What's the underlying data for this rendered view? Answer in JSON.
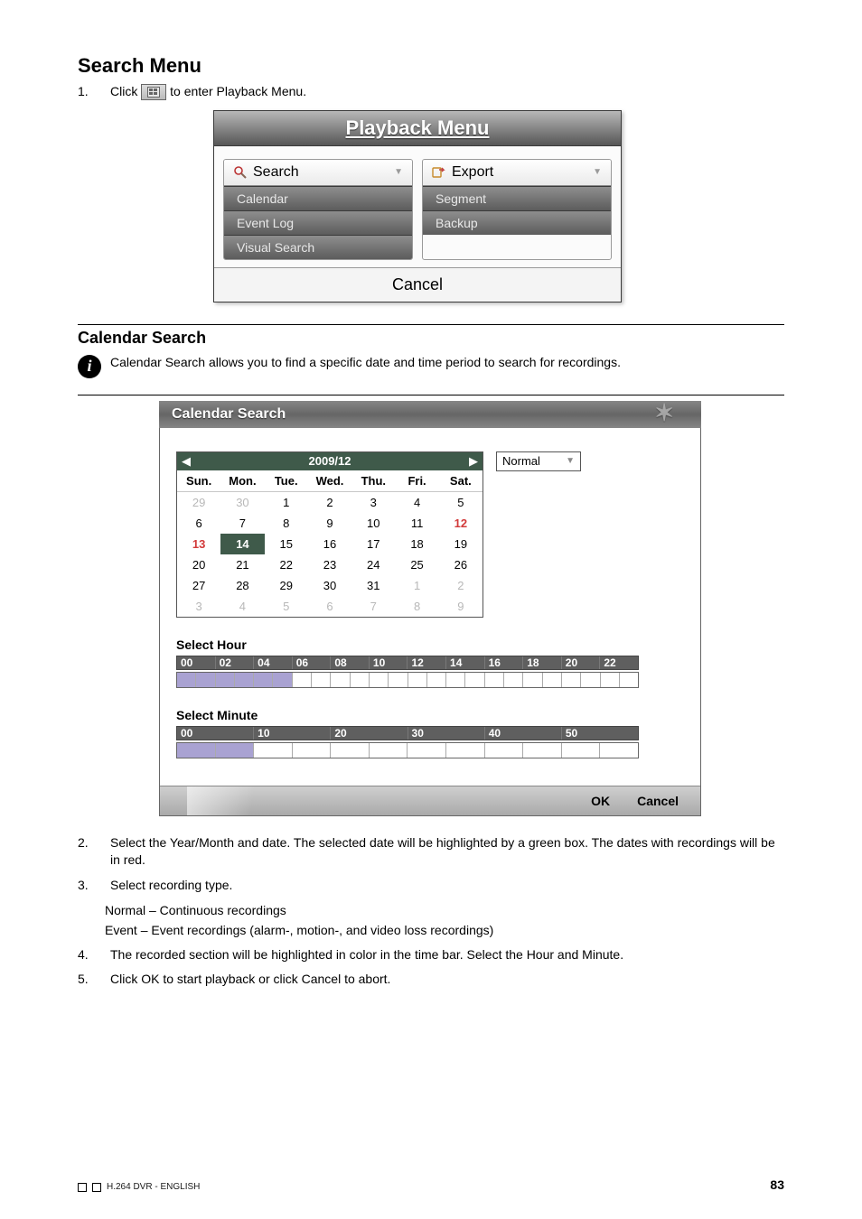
{
  "section1_title": "Search Menu",
  "step1_num": "1.",
  "step1_a": "Click ",
  "step1_b": " to enter Playback Menu.",
  "playback_menu": {
    "title": "Playback Menu",
    "search_head": "Search",
    "export_head": "Export",
    "search_items": [
      "Calendar",
      "Event Log",
      "Visual Search"
    ],
    "export_items": [
      "Segment",
      "Backup"
    ],
    "cancel": "Cancel"
  },
  "section2_title": "Calendar Search",
  "info_text": "Calendar Search allows you to find a specific date and time period to search for recordings.",
  "cs": {
    "title": "Calendar Search",
    "yearmonth": "2009/12",
    "dow": [
      "Sun.",
      "Mon.",
      "Tue.",
      "Wed.",
      "Thu.",
      "Fri.",
      "Sat."
    ],
    "days": [
      {
        "t": "29",
        "c": "muted"
      },
      {
        "t": "30",
        "c": "muted"
      },
      {
        "t": "1",
        "c": ""
      },
      {
        "t": "2",
        "c": ""
      },
      {
        "t": "3",
        "c": ""
      },
      {
        "t": "4",
        "c": ""
      },
      {
        "t": "5",
        "c": ""
      },
      {
        "t": "6",
        "c": ""
      },
      {
        "t": "7",
        "c": ""
      },
      {
        "t": "8",
        "c": ""
      },
      {
        "t": "9",
        "c": ""
      },
      {
        "t": "10",
        "c": ""
      },
      {
        "t": "11",
        "c": ""
      },
      {
        "t": "12",
        "c": "red"
      },
      {
        "t": "13",
        "c": "red"
      },
      {
        "t": "14",
        "c": "sel"
      },
      {
        "t": "15",
        "c": ""
      },
      {
        "t": "16",
        "c": ""
      },
      {
        "t": "17",
        "c": ""
      },
      {
        "t": "18",
        "c": ""
      },
      {
        "t": "19",
        "c": ""
      },
      {
        "t": "20",
        "c": ""
      },
      {
        "t": "21",
        "c": ""
      },
      {
        "t": "22",
        "c": ""
      },
      {
        "t": "23",
        "c": ""
      },
      {
        "t": "24",
        "c": ""
      },
      {
        "t": "25",
        "c": ""
      },
      {
        "t": "26",
        "c": ""
      },
      {
        "t": "27",
        "c": ""
      },
      {
        "t": "28",
        "c": ""
      },
      {
        "t": "29",
        "c": ""
      },
      {
        "t": "30",
        "c": ""
      },
      {
        "t": "31",
        "c": ""
      },
      {
        "t": "1",
        "c": "muted"
      },
      {
        "t": "2",
        "c": "muted"
      },
      {
        "t": "3",
        "c": "muted"
      },
      {
        "t": "4",
        "c": "muted"
      },
      {
        "t": "5",
        "c": "muted"
      },
      {
        "t": "6",
        "c": "muted"
      },
      {
        "t": "7",
        "c": "muted"
      },
      {
        "t": "8",
        "c": "muted"
      },
      {
        "t": "9",
        "c": "muted"
      }
    ],
    "normal": "Normal",
    "select_hour": "Select Hour",
    "hours": [
      "00",
      "02",
      "04",
      "06",
      "08",
      "10",
      "12",
      "14",
      "16",
      "18",
      "20",
      "22"
    ],
    "hour_fill": [
      true,
      true,
      true,
      true,
      true,
      true,
      false,
      false,
      false,
      false,
      false,
      false,
      false,
      false,
      false,
      false,
      false,
      false,
      false,
      false,
      false,
      false,
      false,
      false
    ],
    "select_minute": "Select Minute",
    "minutes": [
      "00",
      "10",
      "20",
      "30",
      "40",
      "50"
    ],
    "minute_fill": [
      true,
      true,
      false,
      false,
      false,
      false,
      false,
      false,
      false,
      false,
      false,
      false
    ],
    "ok": "OK",
    "cancel": "Cancel"
  },
  "step2_num": "2.",
  "step2_text": "Select the Year/Month and date. The selected date will be highlighted by a green box. The dates with recordings will be in red.",
  "step3_num": "3.",
  "step3_a": "Select recording type.",
  "step3_b": "Normal – Continuous recordings",
  "step3_c": "Event – Event recordings (alarm-, motion-, and video loss recordings)",
  "step4_num": "4.",
  "step4_text": "The recorded section will be highlighted in color in the time bar. Select the Hour and Minute.",
  "step5_num": "5.",
  "step5_text": "Click OK to start playback or click Cancel to abort.",
  "page_num": "83",
  "footer": "H.264 DVR - ENGLISH"
}
